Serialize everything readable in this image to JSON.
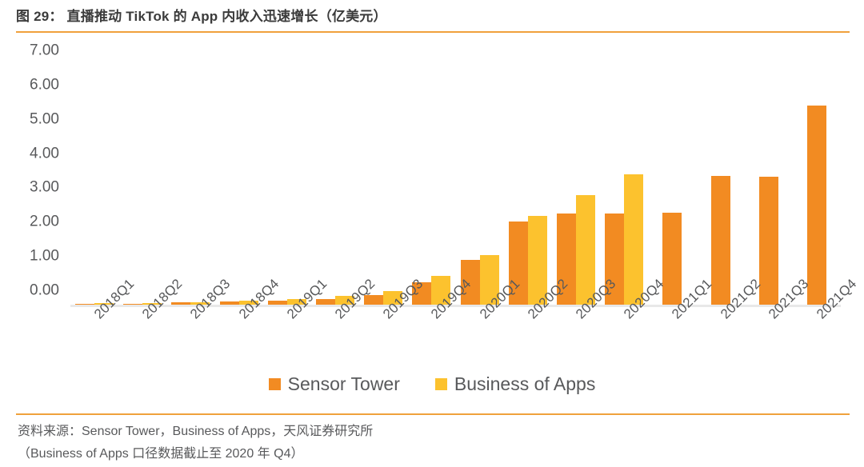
{
  "figure": {
    "title": "图 29： 直播推动 TikTok 的 App 内收入迅速增长（亿美元）",
    "source_line1": "资料来源：Sensor Tower，Business of Apps，天风证券研究所",
    "source_line2": "（Business of Apps 口径数据截止至 2020 年 Q4）",
    "accent_color": "#f0a13c"
  },
  "chart_data": {
    "type": "bar",
    "title": "图 29： 直播推动 TikTok 的 App 内收入迅速增长（亿美元）",
    "xlabel": "",
    "ylabel": "",
    "ylim": [
      0,
      7
    ],
    "yticks": [
      "0.00",
      "1.00",
      "2.00",
      "3.00",
      "4.00",
      "5.00",
      "6.00",
      "7.00"
    ],
    "ytick_values": [
      0,
      1,
      2,
      3,
      4,
      5,
      6,
      7
    ],
    "grid": false,
    "legend_position": "bottom",
    "categories": [
      "2018Q1",
      "2018Q2",
      "2018Q3",
      "2018Q4",
      "2019Q1",
      "2019Q2",
      "2019Q3",
      "2019Q4",
      "2020Q1",
      "2020Q2",
      "2020Q3",
      "2020Q4",
      "2021Q1",
      "2021Q2",
      "2021Q3",
      "2021Q4"
    ],
    "series": [
      {
        "name": "Sensor Tower",
        "color": "#F28B22",
        "values": [
          0.02,
          0.03,
          0.06,
          0.09,
          0.12,
          0.17,
          0.28,
          0.65,
          1.3,
          2.42,
          2.65,
          2.67,
          2.68,
          3.75,
          3.73,
          5.8
        ]
      },
      {
        "name": "Business of Apps",
        "color": "#FCC22E",
        "values": [
          0.05,
          0.04,
          0.08,
          0.11,
          0.17,
          0.26,
          0.4,
          0.85,
          1.45,
          2.6,
          3.2,
          3.8,
          null,
          null,
          null,
          null
        ]
      }
    ]
  }
}
